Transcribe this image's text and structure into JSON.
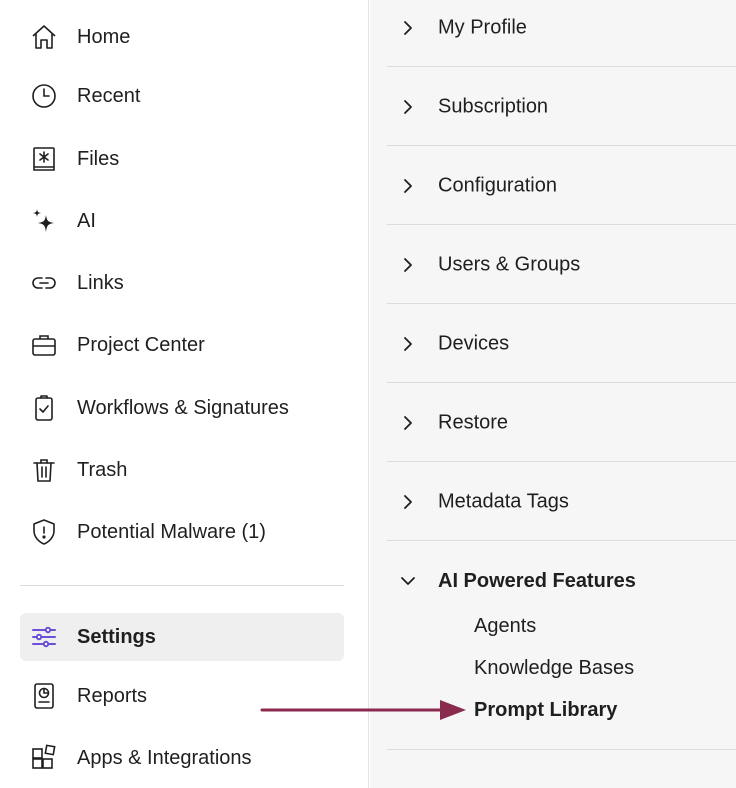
{
  "sidebar": {
    "items": [
      {
        "label": "Home",
        "icon": "home-icon"
      },
      {
        "label": "Recent",
        "icon": "clock-icon"
      },
      {
        "label": "Files",
        "icon": "files-icon"
      },
      {
        "label": "AI",
        "icon": "sparkle-icon"
      },
      {
        "label": "Links",
        "icon": "link-icon"
      },
      {
        "label": "Project Center",
        "icon": "briefcase-icon"
      },
      {
        "label": "Workflows & Signatures",
        "icon": "clipboard-check-icon"
      },
      {
        "label": "Trash",
        "icon": "trash-icon"
      },
      {
        "label": "Potential Malware (1)",
        "icon": "shield-alert-icon"
      }
    ],
    "bottom_items": [
      {
        "label": "Settings",
        "icon": "sliders-icon",
        "active": true
      },
      {
        "label": "Reports",
        "icon": "report-icon"
      },
      {
        "label": "Apps & Integrations",
        "icon": "apps-icon"
      }
    ],
    "accent_color": "#6b4fd6"
  },
  "settings_menu": {
    "sections": [
      {
        "label": "My Profile"
      },
      {
        "label": "Subscription"
      },
      {
        "label": "Configuration"
      },
      {
        "label": "Users & Groups"
      },
      {
        "label": "Devices"
      },
      {
        "label": "Restore"
      },
      {
        "label": "Metadata Tags"
      }
    ],
    "expanded_section": {
      "label": "AI Powered Features",
      "children": [
        {
          "label": "Agents"
        },
        {
          "label": "Knowledge Bases"
        },
        {
          "label": "Prompt Library",
          "highlighted": true
        }
      ]
    }
  },
  "annotation": {
    "arrow_color": "#8a2a4e",
    "points_to": "Prompt Library"
  }
}
